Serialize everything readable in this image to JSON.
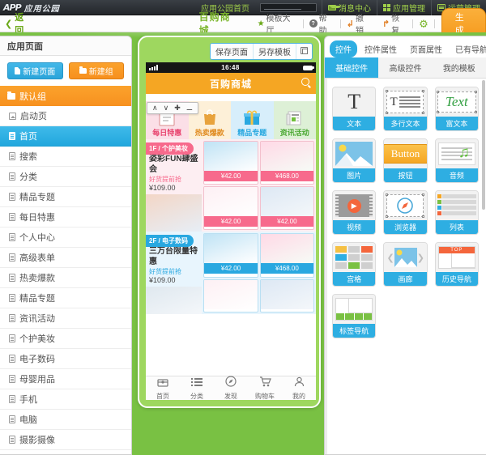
{
  "topbar": {
    "logo_mark": "APP",
    "logo_text": "应用公园",
    "items": [
      {
        "label": "应用公园首页",
        "icon": ""
      },
      {
        "label": "消息中心",
        "icon": "mail-icon"
      },
      {
        "label": "应用管理",
        "icon": "grid-icon"
      },
      {
        "label": "运营管理",
        "icon": "lines-icon"
      }
    ],
    "search_placeholder": ""
  },
  "subbar": {
    "back_label": "返回",
    "app_title": "百购商城",
    "tools": [
      {
        "label": "模板大厅",
        "icon": "star-icon"
      },
      {
        "label": "帮助",
        "icon": "question-icon"
      },
      {
        "label": "撤销",
        "icon": "undo-icon"
      },
      {
        "label": "恢复",
        "icon": "redo-icon"
      }
    ],
    "gear_icon": "gear-icon",
    "generate_label": "生成"
  },
  "sidebar": {
    "title": "应用页面",
    "new_page_label": "新建页面",
    "new_group_label": "新建组",
    "group_label": "默认组",
    "items": [
      {
        "label": "启动页",
        "icon": "image-doc-icon",
        "active": false
      },
      {
        "label": "首页",
        "icon": "doc-icon",
        "active": true
      },
      {
        "label": "搜索",
        "icon": "doc-icon",
        "active": false
      },
      {
        "label": "分类",
        "icon": "doc-icon",
        "active": false
      },
      {
        "label": "精品专题",
        "icon": "doc-icon",
        "active": false
      },
      {
        "label": "每日特惠",
        "icon": "doc-icon",
        "active": false
      },
      {
        "label": "个人中心",
        "icon": "doc-icon",
        "active": false
      },
      {
        "label": "高级表单",
        "icon": "doc-icon",
        "active": false
      },
      {
        "label": "热卖爆款",
        "icon": "doc-icon",
        "active": false
      },
      {
        "label": "精品专题",
        "icon": "doc-icon",
        "active": false
      },
      {
        "label": "资讯活动",
        "icon": "doc-icon",
        "active": false
      },
      {
        "label": "个护美妆",
        "icon": "doc-icon",
        "active": false
      },
      {
        "label": "电子数码",
        "icon": "doc-icon",
        "active": false
      },
      {
        "label": "母婴用品",
        "icon": "doc-icon",
        "active": false
      },
      {
        "label": "手机",
        "icon": "doc-icon",
        "active": false
      },
      {
        "label": "电脑",
        "icon": "doc-icon",
        "active": false
      },
      {
        "label": "摄影摄像",
        "icon": "doc-icon",
        "active": false
      }
    ]
  },
  "canvas": {
    "toolbar": [
      {
        "label": "保存页面"
      },
      {
        "label": "另存模板"
      },
      {
        "label": "",
        "icon": "preview-icon"
      }
    ],
    "phone": {
      "status": {
        "time": "16:48",
        "signal_icon": "signal-icon",
        "battery_icon": "battery-icon"
      },
      "app_header": {
        "title": "百购商城",
        "search_icon": "search-icon"
      },
      "edit_toolbar": [
        {
          "icon": "chevron-up-icon",
          "glyph": "∧"
        },
        {
          "icon": "chevron-down-icon",
          "glyph": "∨"
        },
        {
          "icon": "plus-icon",
          "glyph": "✚"
        },
        {
          "icon": "trash-icon",
          "glyph": "Ὕ1"
        }
      ],
      "categories": [
        {
          "label": "每日特惠",
          "color": "#e8426d",
          "bg": "#fbdfe7",
          "icon": "calendar-icon"
        },
        {
          "label": "热卖爆款",
          "color": "#e08a1e",
          "bg": "#fdf0d8",
          "icon": "bag-icon"
        },
        {
          "label": "精品专题",
          "color": "#28a8e0",
          "bg": "#d7eefb",
          "icon": "gift-icon"
        },
        {
          "label": "资讯活动",
          "color": "#4aa832",
          "bg": "#ddf0d6",
          "icon": "news-icon"
        }
      ],
      "floors": [
        {
          "banner": "1F / 个护美妆",
          "headline": "姿彩FUN肆盛会",
          "sub": "好货提前抢",
          "price": "¥109.00",
          "accent": "#f76a8c",
          "tiles": [
            {
              "price": "¥42.00"
            },
            {
              "price": "¥468.00"
            },
            {
              "price": "¥42.00"
            },
            {
              "price": "¥42.00"
            }
          ]
        },
        {
          "banner": "2F / 电子数码",
          "headline": "三万台限量特惠",
          "sub": "好货提前抢",
          "price": "¥109.00",
          "accent": "#29a8e0",
          "tiles": [
            {
              "price": "¥42.00"
            },
            {
              "price": "¥468.00"
            },
            {
              "price": ""
            },
            {
              "price": ""
            }
          ]
        }
      ],
      "tabbar": [
        {
          "label": "首页",
          "icon": "home-icon"
        },
        {
          "label": "分类",
          "icon": "list-icon"
        },
        {
          "label": "发现",
          "icon": "compass-icon"
        },
        {
          "label": "购物车",
          "icon": "cart-icon"
        },
        {
          "label": "我的",
          "icon": "user-icon"
        }
      ]
    }
  },
  "right_panel": {
    "tabs": [
      {
        "label": "控件",
        "active": true
      },
      {
        "label": "控件属性",
        "active": false
      },
      {
        "label": "页面属性",
        "active": false
      },
      {
        "label": "已有导航",
        "active": false
      }
    ],
    "subtabs": [
      {
        "label": "基础控件",
        "active": true
      },
      {
        "label": "高级控件",
        "active": false
      },
      {
        "label": "我的模板",
        "active": false
      }
    ],
    "widgets": [
      {
        "label": "文本",
        "icon": "text-icon",
        "sample": "T"
      },
      {
        "label": "多行文本",
        "icon": "multiline-text-icon",
        "sample": "T"
      },
      {
        "label": "富文本",
        "icon": "rich-text-icon",
        "sample": "Text"
      },
      {
        "label": "图片",
        "icon": "image-icon",
        "sample": ""
      },
      {
        "label": "按钮",
        "icon": "button-icon",
        "sample": "Button"
      },
      {
        "label": "音频",
        "icon": "audio-icon",
        "sample": ""
      },
      {
        "label": "视频",
        "icon": "video-icon",
        "sample": ""
      },
      {
        "label": "浏览器",
        "icon": "browser-icon",
        "sample": ""
      },
      {
        "label": "列表",
        "icon": "list-widget-icon",
        "sample": ""
      },
      {
        "label": "宫格",
        "icon": "grid-widget-icon",
        "sample": ""
      },
      {
        "label": "画廊",
        "icon": "gallery-icon",
        "sample": ""
      },
      {
        "label": "历史导航",
        "icon": "history-nav-icon",
        "sample": "TOP"
      },
      {
        "label": "标签导航",
        "icon": "tab-nav-icon",
        "sample": ""
      }
    ]
  },
  "colors": {
    "brand_green": "#79c143",
    "accent_blue": "#2eaee2",
    "accent_orange": "#f7911f",
    "header_orange": "#f5a623",
    "pink": "#f76a8c"
  }
}
